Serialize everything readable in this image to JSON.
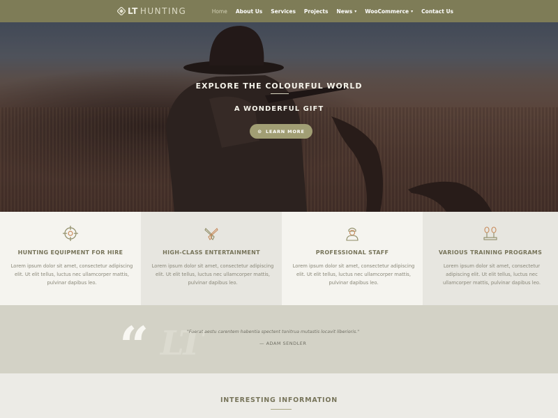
{
  "header": {
    "logo_lt": "LT",
    "logo_hunting": "HUNTING",
    "nav": [
      {
        "label": "Home",
        "active": true
      },
      {
        "label": "About Us"
      },
      {
        "label": "Services"
      },
      {
        "label": "Projects"
      },
      {
        "label": "News",
        "dropdown": true
      },
      {
        "label": "WooCommerce",
        "dropdown": true
      },
      {
        "label": "Contact Us"
      }
    ]
  },
  "hero": {
    "title": "EXPLORE THE COLOURFUL WORLD",
    "subtitle": "A WONDERFUL GIFT",
    "button_icon": "⊙",
    "button_label": "LEARN MORE"
  },
  "features": [
    {
      "icon": "crosshair-icon",
      "title": "HUNTING EQUIPMENT FOR HIRE",
      "text": "Lorem ipsum dolor sit amet, consectetur adipiscing elit. Ut elit tellus, luctus nec ullamcorper mattis, pulvinar dapibus leo."
    },
    {
      "icon": "crossed-pistols-icon",
      "title": "HIGH-CLASS ENTERTAINMENT",
      "text": "Lorem ipsum dolor sit amet, consectetur adipiscing elit. Ut elit tellus, luctus nec ullamcorper mattis, pulvinar dapibus leo."
    },
    {
      "icon": "soldier-icon",
      "title": "PROFESSIONAL STAFF",
      "text": "Lorem ipsum dolor sit amet, consectetur adipiscing elit. Ut elit tellus, luctus nec ullamcorper mattis, pulvinar dapibus leo."
    },
    {
      "icon": "ducks-icon",
      "title": "VARIOUS TRAINING PROGRAMS",
      "text": "Lorem ipsum dolor sit amet, consectetur adipiscing elit. Ut elit tellus, luctus nec ullamcorper mattis, pulvinar dapibus leo."
    }
  ],
  "testimonial": {
    "quote_mark": "“",
    "watermark": "LT",
    "quote": "\"Fuerat aestu carentem habentia spectent tonitrua mutastis locavit liberioris.\"",
    "author": "— ADAM SENDLER"
  },
  "info": {
    "title": "INTERESTING INFORMATION"
  },
  "colors": {
    "header_bg": "#7e7c57",
    "accent": "#a19e74",
    "feature_title": "#77745a"
  }
}
